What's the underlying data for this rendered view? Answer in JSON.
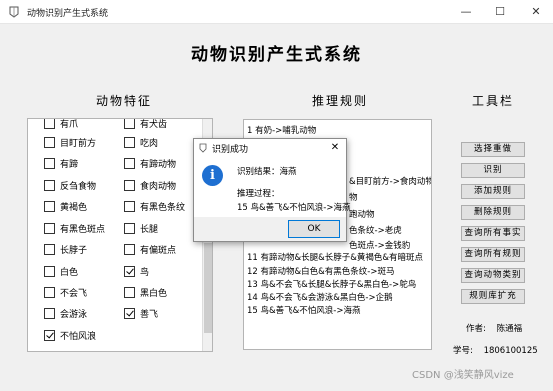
{
  "window": {
    "title": "动物识别产生式系统",
    "minimize_glyph": "—",
    "maximize_glyph": "☐",
    "close_glyph": "✕"
  },
  "header": {
    "title": "动物识别产生式系统"
  },
  "sections": {
    "features_label": "动物特征",
    "rules_label": "推理规则",
    "toolbar_label": "工具栏"
  },
  "features": [
    {
      "label": "有爪",
      "checked": false
    },
    {
      "label": "有犬齿",
      "checked": false
    },
    {
      "label": "目盯前方",
      "checked": false
    },
    {
      "label": "吃肉",
      "checked": false
    },
    {
      "label": "有蹄",
      "checked": false
    },
    {
      "label": "有蹄动物",
      "checked": false
    },
    {
      "label": "反刍食物",
      "checked": false
    },
    {
      "label": "食肉动物",
      "checked": false
    },
    {
      "label": "黄褐色",
      "checked": false
    },
    {
      "label": "有黑色条纹",
      "checked": false
    },
    {
      "label": "有黑色斑点",
      "checked": false
    },
    {
      "label": "长腿",
      "checked": false
    },
    {
      "label": "长脖子",
      "checked": false
    },
    {
      "label": "有偏斑点",
      "checked": false
    },
    {
      "label": "白色",
      "checked": false
    },
    {
      "label": "鸟",
      "checked": true
    },
    {
      "label": "不会飞",
      "checked": false
    },
    {
      "label": "黑白色",
      "checked": false
    },
    {
      "label": "会游泳",
      "checked": false
    },
    {
      "label": "善飞",
      "checked": true
    },
    {
      "label": "不怕风浪",
      "checked": true
    }
  ],
  "rules": [
    "1  有奶->哺乳动物",
    "&目盯前方->食肉动物",
    "物",
    "跑动物",
    "色条纹->老虎",
    "色斑点->金钱豹",
    "11  有蹄动物&长腿&长脖子&黄褐色&有暗斑点",
    "12  有蹄动物&白色&有黑色条纹->斑马",
    "13  鸟&不会飞&长腿&长脖子&黑白色->鸵鸟",
    "14  鸟&不会飞&会游泳&黑白色->企鹅",
    "15  鸟&善飞&不怕风浪->海燕"
  ],
  "toolbar": {
    "buttons": [
      "选择重做",
      "识别",
      "添加规则",
      "删除规则",
      "查询所有事实",
      "查询所有规则",
      "查询动物类别",
      "规则库扩充"
    ]
  },
  "author": {
    "label": "作者:",
    "name": "陈通福"
  },
  "student_id": {
    "label": "学号:",
    "value": "1806100125"
  },
  "dialog": {
    "title": "识别成功",
    "close_glyph": "✕",
    "info_glyph": "i",
    "result_line": "识别结果：海燕",
    "process_label": "推理过程：",
    "process_line": "15 鸟&善飞&不怕风浪->海燕",
    "ok_label": "OK"
  },
  "watermark": "CSDN @浅笑静风vize"
}
